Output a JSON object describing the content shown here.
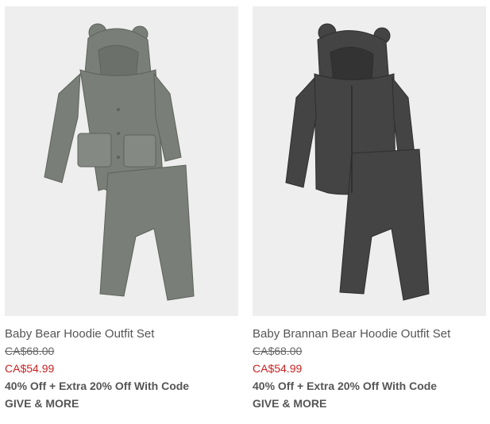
{
  "products": [
    {
      "name": "Baby Bear Hoodie Outfit Set",
      "original_price": "CA$68.00",
      "sale_price": "CA$54.99",
      "promo_line1": "40% Off + Extra 20% Off With Code",
      "promo_line2": "GIVE & MORE",
      "color": "#7a7e78"
    },
    {
      "name": "Baby Brannan Bear Hoodie Outfit Set",
      "original_price": "CA$68.00",
      "sale_price": "CA$54.99",
      "promo_line1": "40% Off + Extra 20% Off With Code",
      "promo_line2": "GIVE & MORE",
      "color": "#444444"
    }
  ],
  "colors": {
    "sale": "#cc1f1f",
    "image_bg": "#eeeeee",
    "text": "#555555"
  }
}
